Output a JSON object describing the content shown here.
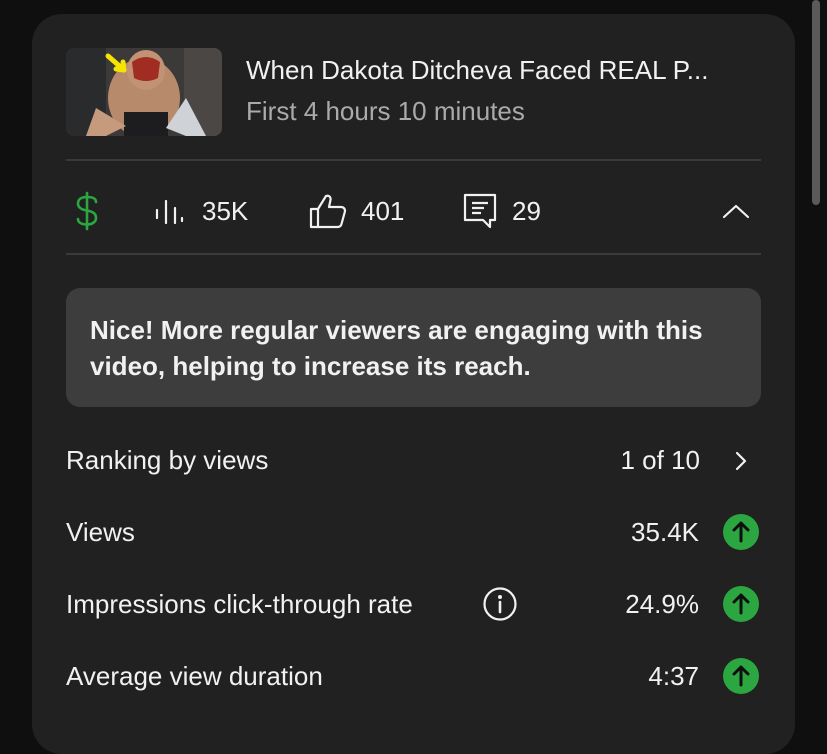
{
  "video": {
    "title": "When Dakota Ditcheva Faced REAL P...",
    "period": "First 4 hours 10 minutes"
  },
  "stats": {
    "monetization_icon": "dollar-sign-icon",
    "views": "35K",
    "likes": "401",
    "comments": "29"
  },
  "notice": {
    "text": "Nice! More regular viewers are engaging with this video, helping to increase its reach."
  },
  "metrics": [
    {
      "label": "Ranking by views",
      "value": "1 of 10",
      "indicator": "chevron-right-icon"
    },
    {
      "label": "Views",
      "value": "35.4K",
      "indicator": "arrow-up-icon"
    },
    {
      "label": "Impressions click-through rate",
      "value": "24.9%",
      "indicator": "arrow-up-icon"
    },
    {
      "label": "Average view duration",
      "value": "4:37",
      "indicator": "arrow-up-icon"
    }
  ],
  "colors": {
    "background": "#0f0f0f",
    "card": "#212121",
    "notice": "#3d3d3d",
    "positive": "#2ba640",
    "muted_text": "#aaaaaa"
  }
}
